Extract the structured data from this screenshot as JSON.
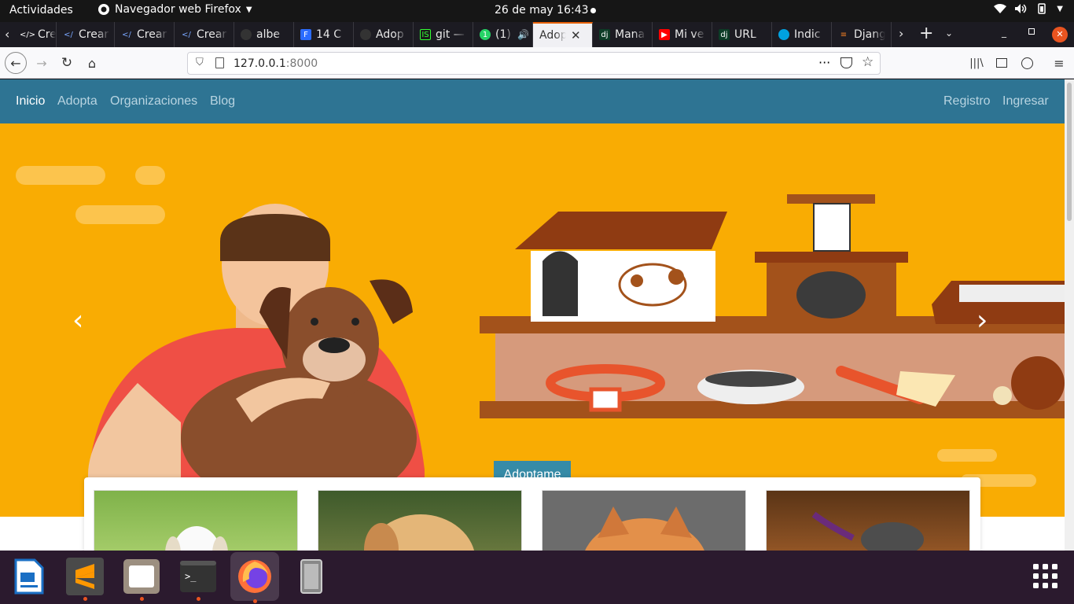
{
  "topbar": {
    "activities": "Actividades",
    "app_name": "Navegador web Firefox",
    "clock": "26 de may  16:43"
  },
  "tabs": [
    {
      "title": "Crear",
      "icon": "code-icon"
    },
    {
      "title": "Crear",
      "icon": "code-icon"
    },
    {
      "title": "Crear",
      "icon": "code-icon"
    },
    {
      "title": "Crear",
      "icon": "code-icon"
    },
    {
      "title": "albe",
      "icon": "github-icon"
    },
    {
      "title": "14 C",
      "icon": "badge-icon"
    },
    {
      "title": "Adop",
      "icon": "github-icon"
    },
    {
      "title": "git —",
      "icon": "terminal-icon"
    },
    {
      "title": "(1)",
      "icon": "whatsapp-icon"
    },
    {
      "title": "Adop",
      "icon": "page-icon"
    },
    {
      "title": "Mana",
      "icon": "django-icon"
    },
    {
      "title": "Mi ve",
      "icon": "youtube-icon"
    },
    {
      "title": "URL",
      "icon": "django-icon"
    },
    {
      "title": "Indic",
      "icon": "salesforce-icon"
    },
    {
      "title": "Djang",
      "icon": "stackoverflow-icon"
    }
  ],
  "url": {
    "host": "127.0.0.1",
    "port": ":8000"
  },
  "site": {
    "nav_inicio": "Inicio",
    "nav_adopta": "Adopta",
    "nav_orgs": "Organizaciones",
    "nav_blog": "Blog",
    "nav_registro": "Registro",
    "nav_ingresar": "Ingresar",
    "hero_button": "Adoptame"
  },
  "carousel": {
    "slide_count": 4,
    "active_slide": 1
  },
  "colors": {
    "navbar": "#2e7493",
    "hero_bg": "#f9ac03",
    "button": "#368ba7",
    "dock": "#2b1a2e"
  }
}
